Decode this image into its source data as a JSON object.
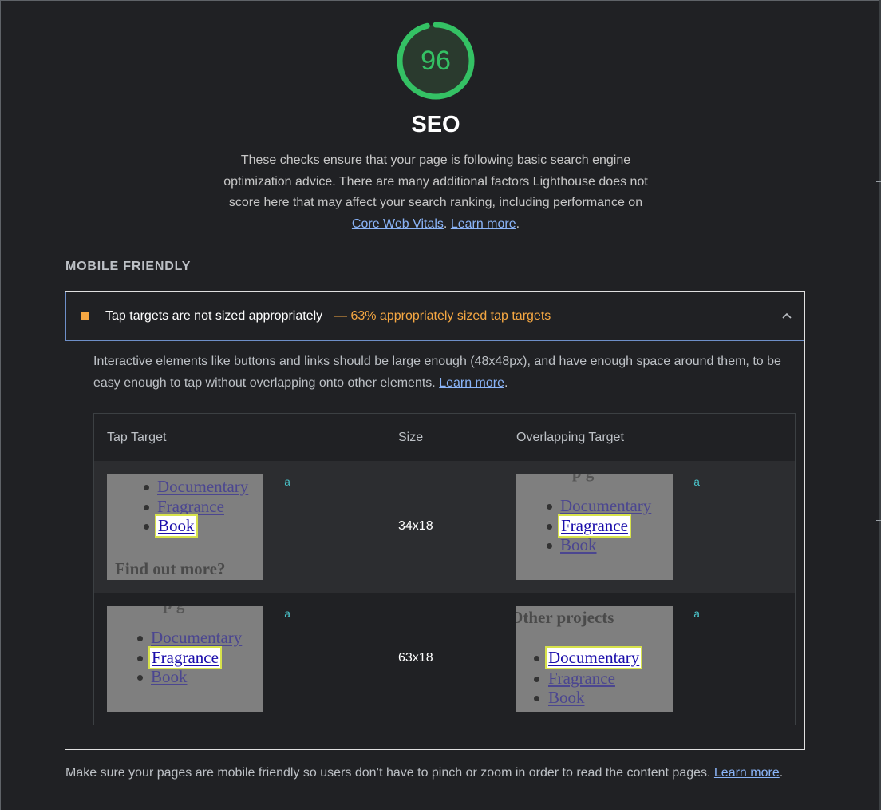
{
  "score": {
    "value": "96",
    "color": "#34c164",
    "fraction": 0.96
  },
  "category": {
    "title": "SEO",
    "description_prefix": "These checks ensure that your page is following basic search engine optimization advice. There are many additional factors Lighthouse does not score here that may affect your search ranking, including performance on ",
    "core_web_vitals_link": "Core Web Vitals",
    "separator": ". ",
    "learn_more_link": "Learn more",
    "suffix": "."
  },
  "group": {
    "title": "MOBILE FRIENDLY",
    "footer_prefix": "Make sure your pages are mobile friendly so users don’t have to pinch or zoom in order to read the content pages. ",
    "footer_link": "Learn more",
    "footer_suffix": "."
  },
  "audit": {
    "status_color": "#f5a742",
    "title": "Tap targets are not sized appropriately",
    "display_value": "— 63% appropriately sized tap targets",
    "description": "Interactive elements like buttons and links should be large enough (48x48px), and have enough space around them, to be easy enough to tap without overlapping onto other elements. ",
    "learn_more": "Learn more",
    "suffix": ".",
    "expand_icon": "chevron-up-icon"
  },
  "table": {
    "headers": [
      "Tap Target",
      "Size",
      "Overlapping Target"
    ],
    "rows": [
      {
        "tap_node": "a",
        "size": "34x18",
        "overlap_node": "a",
        "tap_thumb": {
          "items": [
            "Documentary",
            "Fragrance",
            "Book"
          ],
          "highlight": "Book",
          "heading": "Find out more?"
        },
        "overlap_thumb": {
          "items": [
            "Documentary",
            "Fragrance",
            "Book"
          ],
          "highlight": "Fragrance"
        }
      },
      {
        "tap_node": "a",
        "size": "63x18",
        "overlap_node": "a",
        "tap_thumb": {
          "items": [
            "Documentary",
            "Fragrance",
            "Book"
          ],
          "highlight": "Fragrance"
        },
        "overlap_thumb": {
          "heading": "Other projects",
          "items": [
            "Documentary",
            "Fragrance",
            "Book"
          ],
          "highlight": "Documentary"
        }
      }
    ]
  }
}
